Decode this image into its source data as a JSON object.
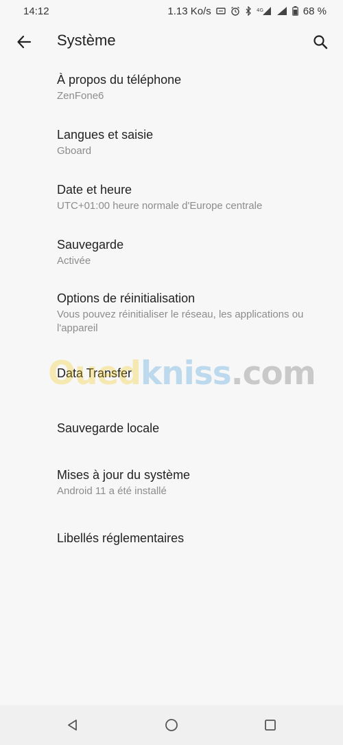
{
  "status_bar": {
    "time": "14:12",
    "speed": "1.13 Ko/s",
    "battery": "68 %",
    "icons": [
      "nfc-icon",
      "alarm-icon",
      "bluetooth-icon",
      "4g-signal-icon",
      "signal-icon",
      "battery-icon"
    ]
  },
  "app_bar": {
    "title": "Système",
    "back_icon": "arrow-left-icon",
    "search_icon": "search-icon"
  },
  "items": [
    {
      "title": "À propos du téléphone",
      "summary": "ZenFone6"
    },
    {
      "title": "Langues et saisie",
      "summary": "Gboard"
    },
    {
      "title": "Date et heure",
      "summary": "UTC+01:00 heure normale d'Europe centrale"
    },
    {
      "title": "Sauvegarde",
      "summary": "Activée"
    },
    {
      "title": "Options de réinitialisation",
      "summary": "Vous pouvez réinitialiser le réseau, les applications ou l'appareil"
    },
    {
      "title": "Data Transfer",
      "summary": ""
    },
    {
      "title": "Sauvegarde locale",
      "summary": ""
    },
    {
      "title": "Mises à jour du système",
      "summary": "Android 11 a été installé"
    },
    {
      "title": "Libellés réglementaires",
      "summary": ""
    }
  ],
  "watermark": {
    "part1": "Oued",
    "part2": "kniss",
    "part3": ".com"
  },
  "nav_bar": {
    "icons": [
      "back-triangle-icon",
      "home-circle-icon",
      "recents-square-icon"
    ]
  }
}
